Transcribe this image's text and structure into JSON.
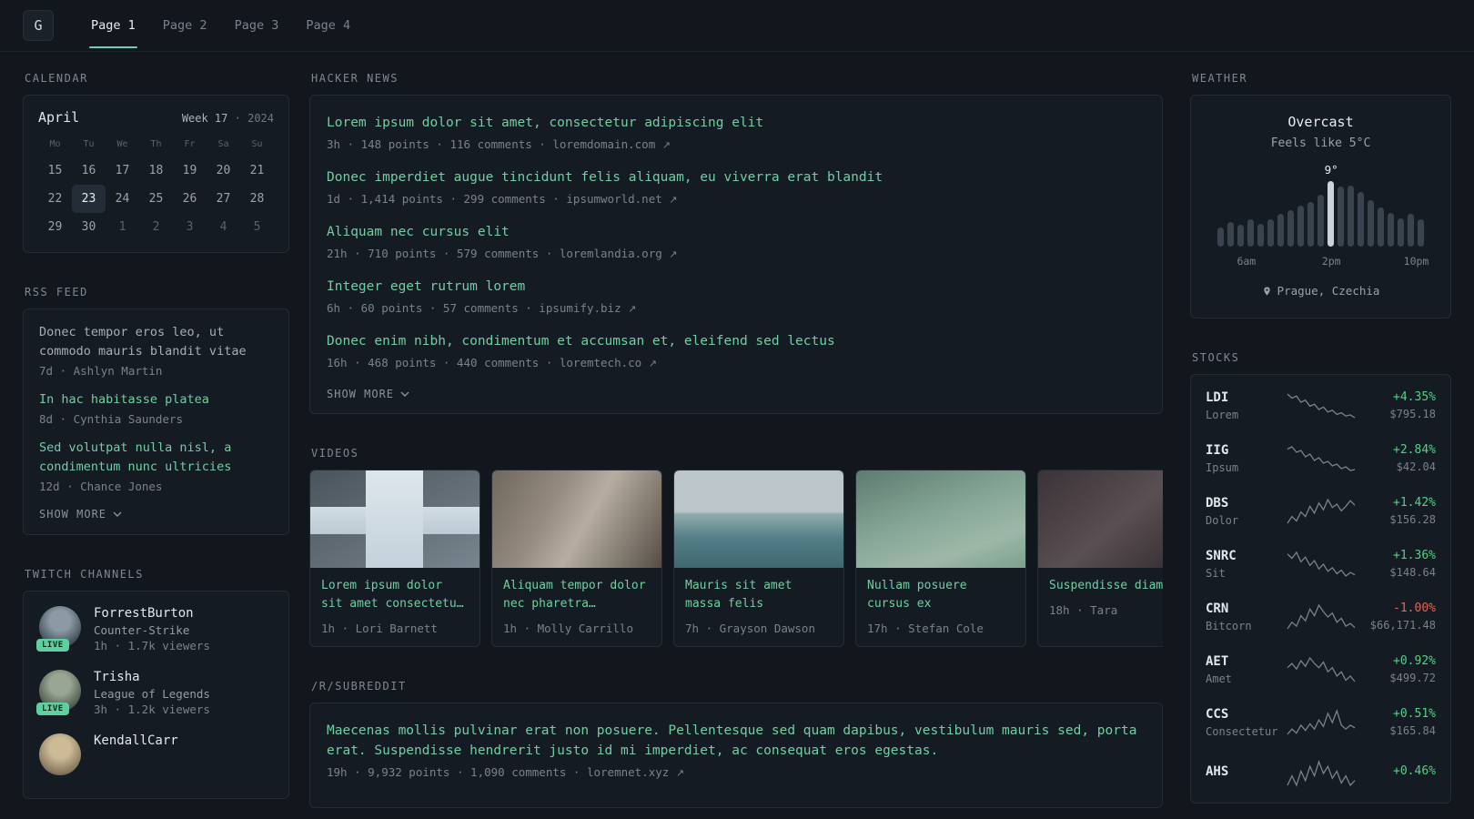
{
  "colors": {
    "accent": "#6fcfad",
    "positive": "#57cf8b",
    "negative": "#e0685a"
  },
  "icons": {
    "external_link": "↗"
  },
  "header": {
    "logo": "G",
    "tabs": [
      {
        "label": "Page 1"
      },
      {
        "label": "Page 2"
      },
      {
        "label": "Page 3"
      },
      {
        "label": "Page 4"
      }
    ]
  },
  "calendar": {
    "heading": "CALENDAR",
    "month": "April",
    "week_label": "Week 17",
    "separator": "·",
    "year": "2024",
    "dow": [
      "Mo",
      "Tu",
      "We",
      "Th",
      "Fr",
      "Sa",
      "Su"
    ],
    "weeks": [
      [
        "15",
        "16",
        "17",
        "18",
        "19",
        "20",
        "21"
      ],
      [
        "22",
        "23",
        "24",
        "25",
        "26",
        "27",
        "28"
      ],
      [
        "29",
        "30",
        "1",
        "2",
        "3",
        "4",
        "5"
      ]
    ],
    "selected_day": "23"
  },
  "rss": {
    "heading": "RSS FEED",
    "items": [
      {
        "title": "Donec tempor eros leo, ut commodo mauris blandit vitae",
        "meta": "7d · Ashlyn Martin"
      },
      {
        "title": "In hac habitasse platea",
        "meta": "8d · Cynthia Saunders"
      },
      {
        "title": "Sed volutpat nulla nisl, a condimentum nunc ultricies",
        "meta": "12d · Chance Jones"
      }
    ],
    "show_more": "SHOW MORE"
  },
  "twitch": {
    "heading": "TWITCH CHANNELS",
    "live_label": "LIVE",
    "channels": [
      {
        "name": "ForrestBurton",
        "game": "Counter-Strike",
        "meta": "1h · 1.7k viewers"
      },
      {
        "name": "Trisha",
        "game": "League of Legends",
        "meta": "3h · 1.2k viewers"
      },
      {
        "name": "KendallCarr",
        "game": "",
        "meta": ""
      }
    ]
  },
  "hackernews": {
    "heading": "HACKER NEWS",
    "items": [
      {
        "title": "Lorem ipsum dolor sit amet, consectetur adipiscing elit",
        "meta": "3h · 148 points · 116 comments · loremdomain.com"
      },
      {
        "title": "Donec imperdiet augue tincidunt felis aliquam, eu viverra erat blandit",
        "meta": "1d · 1,414 points · 299 comments · ipsumworld.net"
      },
      {
        "title": "Aliquam nec cursus elit",
        "meta": "21h · 710 points · 579 comments · loremlandia.org"
      },
      {
        "title": "Integer eget rutrum lorem",
        "meta": "6h · 60 points · 57 comments · ipsumify.biz"
      },
      {
        "title": "Donec enim nibh, condimentum et accumsan et, eleifend sed lectus",
        "meta": "16h · 468 points · 440 comments · loremtech.co"
      }
    ],
    "show_more": "SHOW MORE"
  },
  "videos": {
    "heading": "VIDEOS",
    "items": [
      {
        "title": "Lorem ipsum dolor sit amet consectetu…",
        "meta": "1h · Lori Barnett"
      },
      {
        "title": "Aliquam tempor dolor nec pharetra…",
        "meta": "1h · Molly Carrillo"
      },
      {
        "title": "Mauris sit amet massa felis",
        "meta": "7h · Grayson Dawson"
      },
      {
        "title": "Nullam posuere cursus ex",
        "meta": "17h · Stefan Cole"
      },
      {
        "title": "Suspendisse diam",
        "meta": "18h · Tara"
      }
    ]
  },
  "subreddit": {
    "heading": "/R/SUBREDDIT",
    "items": [
      {
        "title": "Maecenas mollis pulvinar erat non posuere. Pellentesque sed quam dapibus, vestibulum mauris sed, porta erat. Suspendisse hendrerit justo id mi imperdiet, ac consequat eros egestas.",
        "meta": "19h · 9,932 points · 1,090 comments · loremnet.xyz"
      }
    ]
  },
  "weather": {
    "heading": "WEATHER",
    "condition": "Overcast",
    "feels_like": "Feels like 5°C",
    "current_temp_label": "9°",
    "bars": [
      14,
      18,
      16,
      20,
      17,
      20,
      24,
      27,
      30,
      33,
      38,
      48,
      44,
      45,
      40,
      34,
      29,
      25,
      21,
      24,
      20
    ],
    "highlight_index": 11,
    "time_labels": [
      "6am",
      "2pm",
      "10pm"
    ],
    "time_label_indices": [
      3,
      11,
      19
    ],
    "location": "Prague, Czechia"
  },
  "stocks": {
    "heading": "STOCKS",
    "items": [
      {
        "symbol": "LDI",
        "name": "Lorem",
        "change": "+4.35%",
        "price": "$795.18",
        "direction": "up",
        "spark": [
          9,
          8,
          8.5,
          7,
          7.5,
          6,
          6.5,
          5.2,
          5.8,
          4.6,
          5,
          4,
          4.4,
          3.6,
          3.9,
          3.2
        ]
      },
      {
        "symbol": "IIG",
        "name": "Ipsum",
        "change": "+2.84%",
        "price": "$42.04",
        "direction": "up",
        "spark": [
          8.5,
          9,
          7.8,
          8.2,
          6.8,
          7.4,
          6,
          6.6,
          5.4,
          5.8,
          4.8,
          5.2,
          4.2,
          4.6,
          3.8,
          4
        ]
      },
      {
        "symbol": "DBS",
        "name": "Dolor",
        "change": "+1.42%",
        "price": "$156.28",
        "direction": "up",
        "spark": [
          3,
          4.2,
          3.4,
          5,
          4.2,
          6,
          4.8,
          6.6,
          5.4,
          7.2,
          5.8,
          6.4,
          5.2,
          6,
          7,
          6.2
        ]
      },
      {
        "symbol": "SNRC",
        "name": "Sit",
        "change": "+1.36%",
        "price": "$148.64",
        "direction": "up",
        "spark": [
          7.5,
          6.8,
          7.8,
          6.2,
          7,
          5.6,
          6.4,
          5,
          5.8,
          4.6,
          5.2,
          4.2,
          4.8,
          3.8,
          4.4,
          4
        ]
      },
      {
        "symbol": "CRN",
        "name": "Bitcorn",
        "change": "-1.00%",
        "price": "$66,171.48",
        "direction": "down",
        "spark": [
          4,
          5,
          4.4,
          6,
          5.2,
          7,
          6,
          7.6,
          6.6,
          5.8,
          6.4,
          5,
          5.6,
          4.4,
          4.8,
          4.2
        ]
      },
      {
        "symbol": "AET",
        "name": "Amet",
        "change": "+0.92%",
        "price": "$499.72",
        "direction": "up",
        "spark": [
          6,
          6.6,
          5.8,
          7,
          6.2,
          7.4,
          6.6,
          6,
          6.8,
          5.4,
          6,
          4.8,
          5.4,
          4.2,
          4.8,
          4
        ]
      },
      {
        "symbol": "CCS",
        "name": "Consectetur",
        "change": "+0.51%",
        "price": "$165.84",
        "direction": "up",
        "spark": [
          4.2,
          5,
          4.4,
          5.6,
          4.8,
          5.8,
          5,
          6.4,
          5.4,
          7.4,
          6,
          7.8,
          5.6,
          5,
          5.6,
          5.2
        ]
      },
      {
        "symbol": "AHS",
        "name": "",
        "change": "+0.46%",
        "price": "",
        "direction": "up",
        "spark": [
          5,
          5.8,
          5,
          6.2,
          5.4,
          6.6,
          5.8,
          7,
          6,
          6.6,
          5.6,
          6.2,
          5.2,
          5.8,
          5,
          5.4
        ]
      }
    ]
  }
}
